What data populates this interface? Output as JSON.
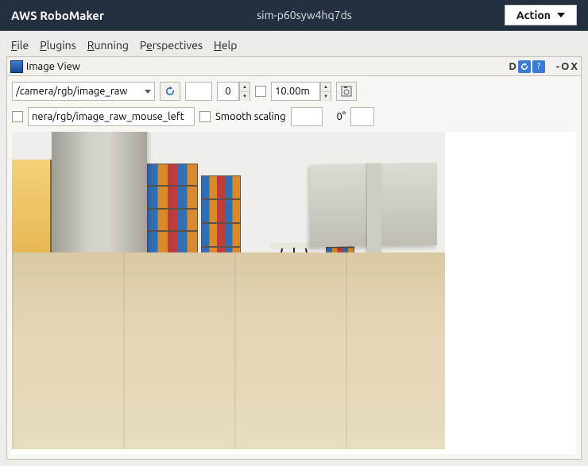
{
  "topbar": {
    "product_name": "AWS RoboMaker",
    "simulation_id": "sim-p60syw4hq7ds",
    "action_label": "Action"
  },
  "menubar": {
    "file": "File",
    "plugins": "Plugins",
    "running": "Running",
    "perspectives": "Perspectives",
    "help": "Help"
  },
  "panel": {
    "title": "Image View",
    "float_label": "D",
    "minimize_label": "-",
    "maximize_label": "O",
    "close_label": "X"
  },
  "toolbar1": {
    "topic": "/camera/rgb/image_raw",
    "field_a": "",
    "spin_value": "0",
    "distance": "10.00m"
  },
  "toolbar2": {
    "mouse_topic": "nera/rgb/image_raw_mouse_left",
    "smooth_label": "Smooth scaling",
    "scale_value": "",
    "angle_label": "0°",
    "angle_value": ""
  }
}
